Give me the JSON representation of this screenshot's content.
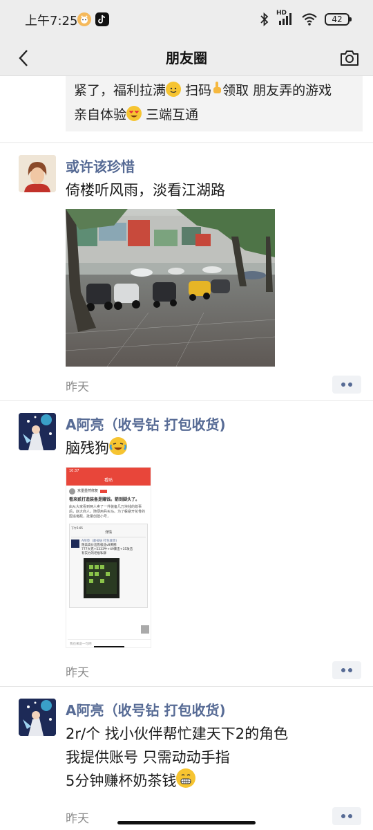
{
  "status": {
    "time": "上午7:25",
    "battery": "42",
    "hd_label": "HD"
  },
  "nav": {
    "title": "朋友圈"
  },
  "prev_post": {
    "line1_a": "紧了，福利拉满",
    "line1_b": " 扫码",
    "line1_c": "领取  朋友弄的游戏",
    "line2_a": "亲自体验",
    "line2_b": " 三端互通"
  },
  "posts": [
    {
      "author": "或许该珍惜",
      "text": "倚楼听风雨，淡看江湖路",
      "time": "昨天"
    },
    {
      "author": "A阿亮（收号钻 打包收货)",
      "text": "脑残狗",
      "time": "昨天",
      "shot": {
        "top_time": "10:37",
        "top_title": "看贴",
        "poster": "京墨墨然修复",
        "headline": "看来贰打造装备是赚钱。箭到脚头了。",
        "body": "由从大家看到两人卖了一件装备几万块钱的故事后，赵大商人，随便用兵买马。为了躲避开花骨的围追堵截，批量创建小号，",
        "inner_time": "下午5:05",
        "inner_title": "详情",
        "inner_author": "A阿亮（收号钻 打包收货)",
        "inner_l1": "隐高高价出售极品v8黄圈",
        "inner_l2": "777大克+5333牛+49暴击+35攻击",
        "inner_l3": "有实力的老板私聊",
        "reply_placeholder": "我也来说一句吧"
      }
    },
    {
      "author": "A阿亮（收号钻 打包收货)",
      "line1": "2r/个 找小伙伴帮忙建天下2的角色",
      "line2": "我提供账号  只需动动手指",
      "line3": "5分钟赚杯奶茶钱",
      "time": "昨天"
    }
  ],
  "colors": {
    "author": "#576b95",
    "bar_bg": "#ededed",
    "time": "#8c8c8c"
  }
}
